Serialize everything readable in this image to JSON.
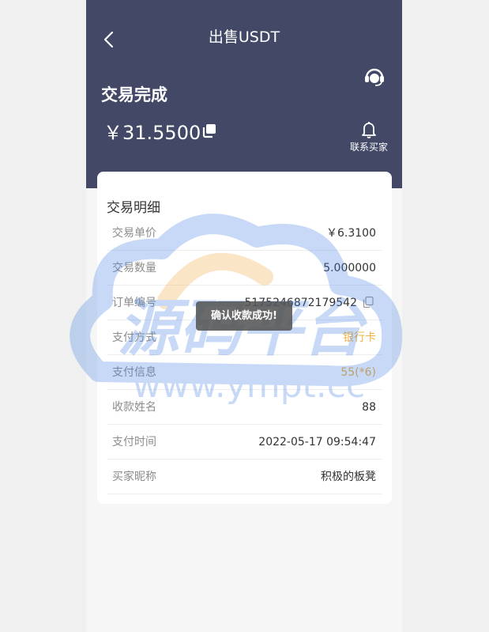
{
  "nav": {
    "title": "出售USDT",
    "back_icon": "chevron-left-icon",
    "support_icon": "customer-service-icon"
  },
  "order": {
    "status": "交易完成",
    "amount": "￥31.5500",
    "copy_icon": "copy-icon",
    "contact_label": "联系买家",
    "contact_icon": "bell-icon"
  },
  "details": {
    "title": "交易明细",
    "rows": [
      {
        "label": "交易单价",
        "value": "￥6.3100"
      },
      {
        "label": "交易数量",
        "value": "5.000000"
      },
      {
        "label": "订单编号",
        "value": "5175246872179542"
      },
      {
        "label": "支付方式",
        "value": "银行卡"
      },
      {
        "label": "支付信息",
        "value": "55(*6)"
      },
      {
        "label": "收款姓名",
        "value": "88"
      },
      {
        "label": "支付时间",
        "value": "2022-05-17 09:54:47"
      },
      {
        "label": "买家昵称",
        "value": "积极的板凳"
      }
    ]
  },
  "toast": {
    "text": "确认收款成功!"
  },
  "watermark": {
    "title": "源码平台",
    "url": "www.ympt.cc"
  },
  "colors": {
    "header_bg": "#424866",
    "accent": "#f0b13f",
    "page_bg": "#f6f6f6",
    "watermark_blue": "#3a7be0",
    "watermark_orange": "#f2a43a"
  }
}
